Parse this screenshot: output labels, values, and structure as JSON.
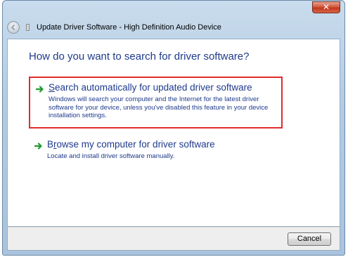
{
  "window": {
    "title": "Update Driver Software - High Definition Audio Device",
    "close_glyph": "✕"
  },
  "content": {
    "heading": "How do you want to search for driver software?",
    "options": [
      {
        "accesskey": "S",
        "title_rest": "earch automatically for updated driver software",
        "description": "Windows will search your computer and the Internet for the latest driver software for your device, unless you've disabled this feature in your device installation settings.",
        "highlighted": true
      },
      {
        "accesskey": "r",
        "title_prefix": "B",
        "title_rest": "owse my computer for driver software",
        "description": "Locate and install driver software manually.",
        "highlighted": false
      }
    ]
  },
  "footer": {
    "cancel_label": "Cancel"
  },
  "colors": {
    "link_blue": "#1e3a8c",
    "highlight_border": "#e22b2b",
    "arrow_green": "#1f9a2e"
  },
  "icons": {
    "back": "back-arrow-icon",
    "device": "audio-device-icon",
    "option_arrow": "green-arrow-icon"
  }
}
